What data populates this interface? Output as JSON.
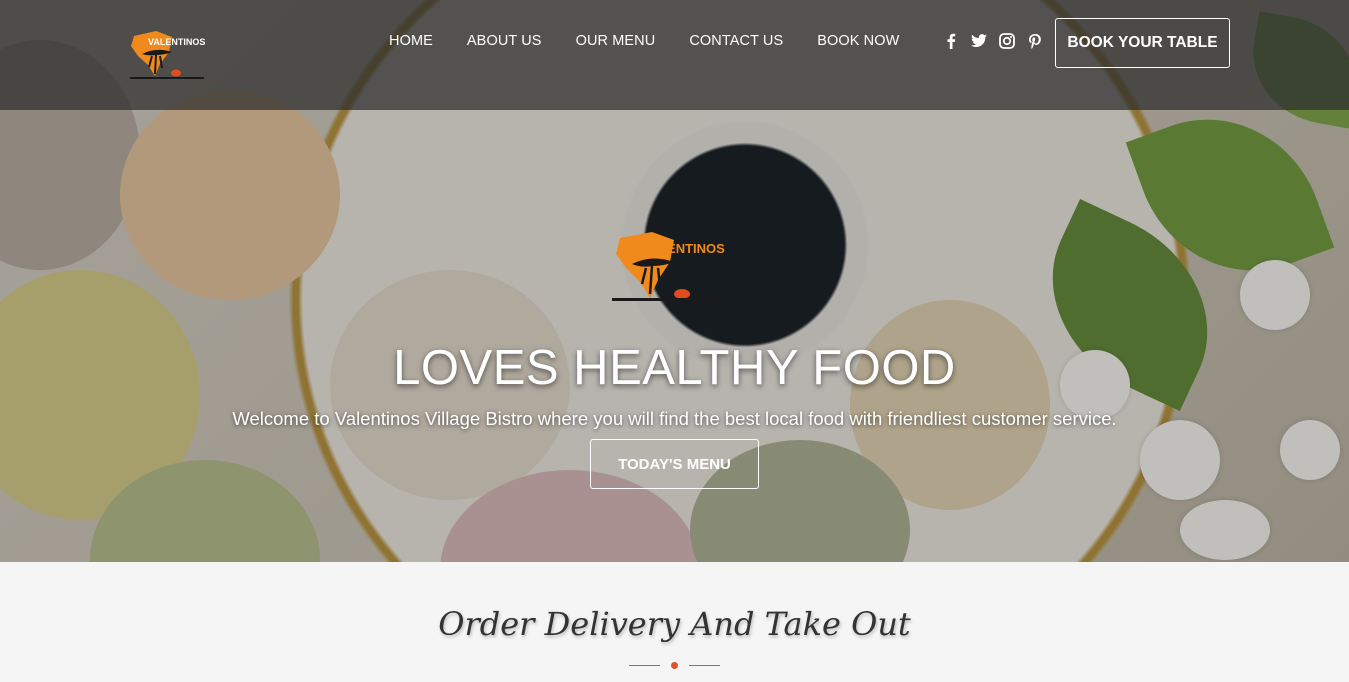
{
  "brand": {
    "name": "VALENTINOS",
    "logo_icon": "acacia-tree-africa-logo"
  },
  "nav": {
    "items": [
      {
        "label": "HOME"
      },
      {
        "label": "ABOUT US"
      },
      {
        "label": "OUR MENU"
      },
      {
        "label": "CONTACT US"
      },
      {
        "label": "BOOK NOW"
      }
    ],
    "social": [
      "facebook-icon",
      "twitter-icon",
      "instagram-icon",
      "pinterest-icon"
    ],
    "cta_label": "BOOK YOUR TABLE"
  },
  "hero": {
    "title": "LOVES HEALTHY FOOD",
    "subtitle": "Welcome to Valentinos Village Bistro where you will find the best local food with friendliest customer service.",
    "button_label": "TODAY'S MENU"
  },
  "section": {
    "title": "Order Delivery And Take Out",
    "accent_color": "#e0512c"
  }
}
